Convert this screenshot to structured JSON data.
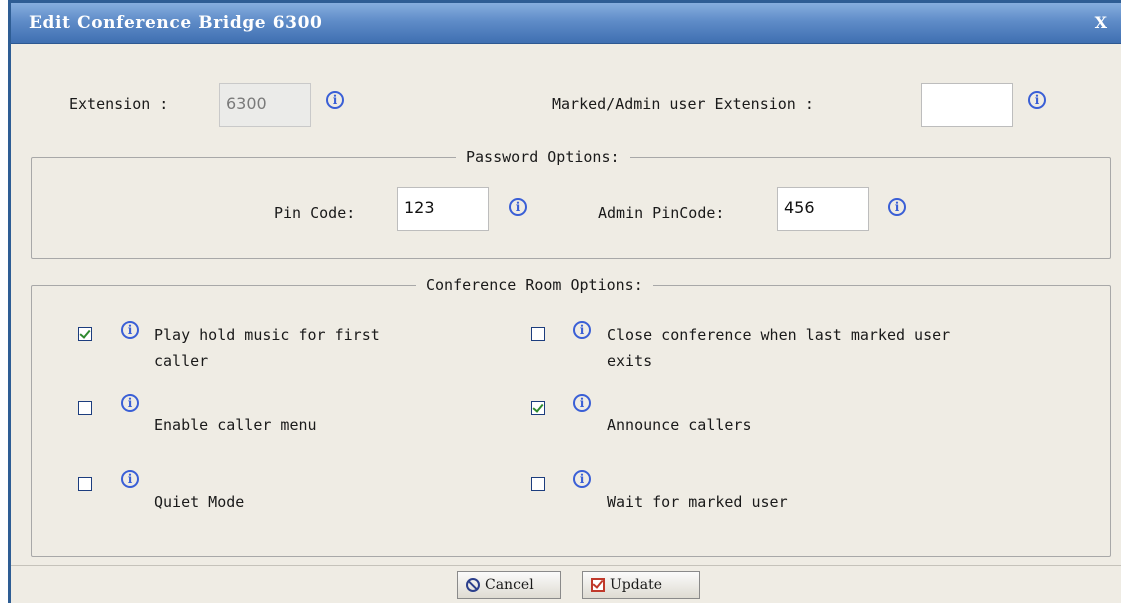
{
  "dialog": {
    "title": "Edit Conference Bridge 6300",
    "close_label": "X"
  },
  "extension": {
    "label": "Extension :",
    "value": "6300"
  },
  "admin_extension": {
    "label": "Marked/Admin user Extension :",
    "value": ""
  },
  "info_glyph": "i",
  "password": {
    "legend": "Password Options:",
    "pin_label": "Pin Code:",
    "pin_value": "123",
    "admin_pin_label": "Admin PinCode:",
    "admin_pin_value": "456"
  },
  "room": {
    "legend": "Conference Room Options:",
    "options": [
      {
        "line1": "Play hold music for first",
        "line2": "caller",
        "checked": true
      },
      {
        "line1": "Close conference when last marked user",
        "line2": "exits",
        "checked": false
      },
      {
        "line1": "Enable caller menu",
        "checked": false
      },
      {
        "line1": "Announce callers",
        "checked": true
      },
      {
        "line1": "Quiet Mode",
        "checked": false
      },
      {
        "line1": "Wait for marked user",
        "checked": false
      }
    ]
  },
  "buttons": {
    "cancel": "Cancel",
    "update": "Update"
  },
  "icons": {
    "info": "info-icon",
    "cancel": "cancel-icon",
    "update": "checkbox-icon",
    "close": "close-icon"
  }
}
